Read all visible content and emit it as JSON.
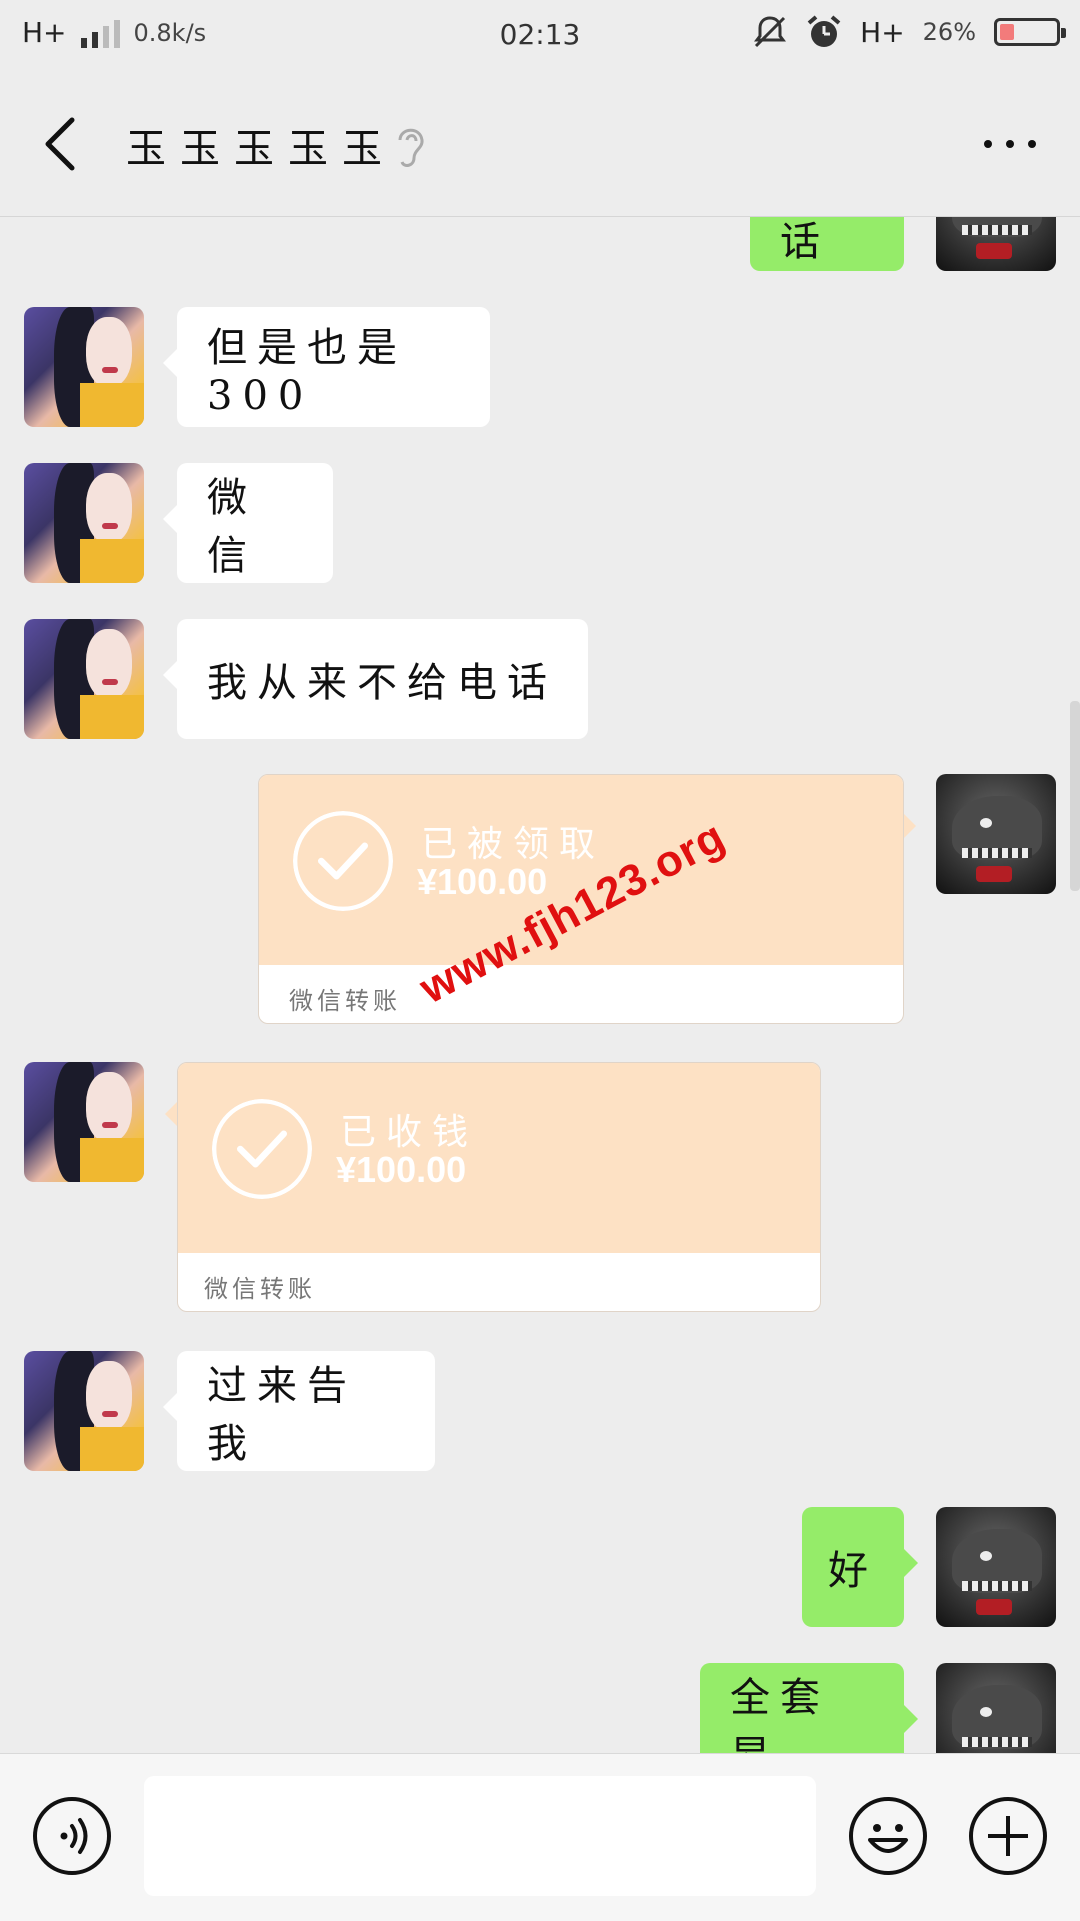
{
  "status_bar": {
    "network_left": "H+",
    "speed": "0.8k/s",
    "time": "02:13",
    "network_right": "H+",
    "battery": "26%",
    "battery_level": 0.26,
    "icons": [
      "signal-icon",
      "mute-bell-icon",
      "alarm-icon",
      "battery-icon"
    ]
  },
  "nav": {
    "title": "玉玉玉玉玉",
    "icons": [
      "back-icon",
      "ear-icon",
      "more-icon"
    ]
  },
  "messages": [
    {
      "side": "out",
      "text": "电话",
      "partial": true
    },
    {
      "side": "in",
      "text": "但是也是300"
    },
    {
      "side": "in",
      "text": "微信"
    },
    {
      "side": "in",
      "text": "我从来不给电话"
    },
    {
      "side": "out",
      "type": "transfer",
      "status": "已被领取",
      "amount": "¥100.00",
      "footer": "微信转账"
    },
    {
      "side": "in",
      "type": "transfer",
      "status": "已收钱",
      "amount": "¥100.00",
      "footer": "微信转账"
    },
    {
      "side": "in",
      "text": "过来告我"
    },
    {
      "side": "out",
      "text": "好"
    },
    {
      "side": "out",
      "text": "全套昂"
    }
  ],
  "watermark": "www.fjh123.org",
  "input_bar": {
    "value": "",
    "icons": [
      "voice-icon",
      "emoji-icon",
      "plus-icon"
    ]
  },
  "colors": {
    "background": "#ededed",
    "outgoing_bubble": "#95ec69",
    "incoming_bubble": "#ffffff",
    "transfer": "#fde1c4",
    "watermark": "#e01010"
  }
}
